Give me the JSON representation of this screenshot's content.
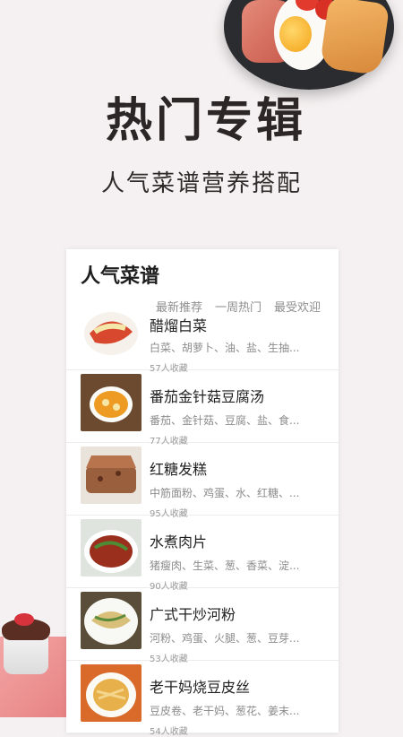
{
  "hero": {
    "title": "热门专辑",
    "subtitle": "人气菜谱营养搭配"
  },
  "card": {
    "title": "人气菜谱",
    "tabs": [
      "最新推荐",
      "一周热门",
      "最受欢迎"
    ]
  },
  "recipes": [
    {
      "name": "醋熘白菜",
      "ingredients": "白菜、胡萝卜、油、盐、生抽...",
      "favorites": "57人收藏"
    },
    {
      "name": "番茄金针菇豆腐汤",
      "ingredients": "番茄、金针菇、豆腐、盐、食...",
      "favorites": "77人收藏"
    },
    {
      "name": "红糖发糕",
      "ingredients": "中筋面粉、鸡蛋、水、红糖、...",
      "favorites": "95人收藏"
    },
    {
      "name": "水煮肉片",
      "ingredients": "猪瘦肉、生菜、葱、香菜、淀...",
      "favorites": "90人收藏"
    },
    {
      "name": "广式干炒河粉",
      "ingredients": "河粉、鸡蛋、火腿、葱、豆芽...",
      "favorites": "53人收藏"
    },
    {
      "name": "老干妈烧豆皮丝",
      "ingredients": "豆皮卷、老干妈、葱花、姜末...",
      "favorites": "54人收藏"
    }
  ]
}
